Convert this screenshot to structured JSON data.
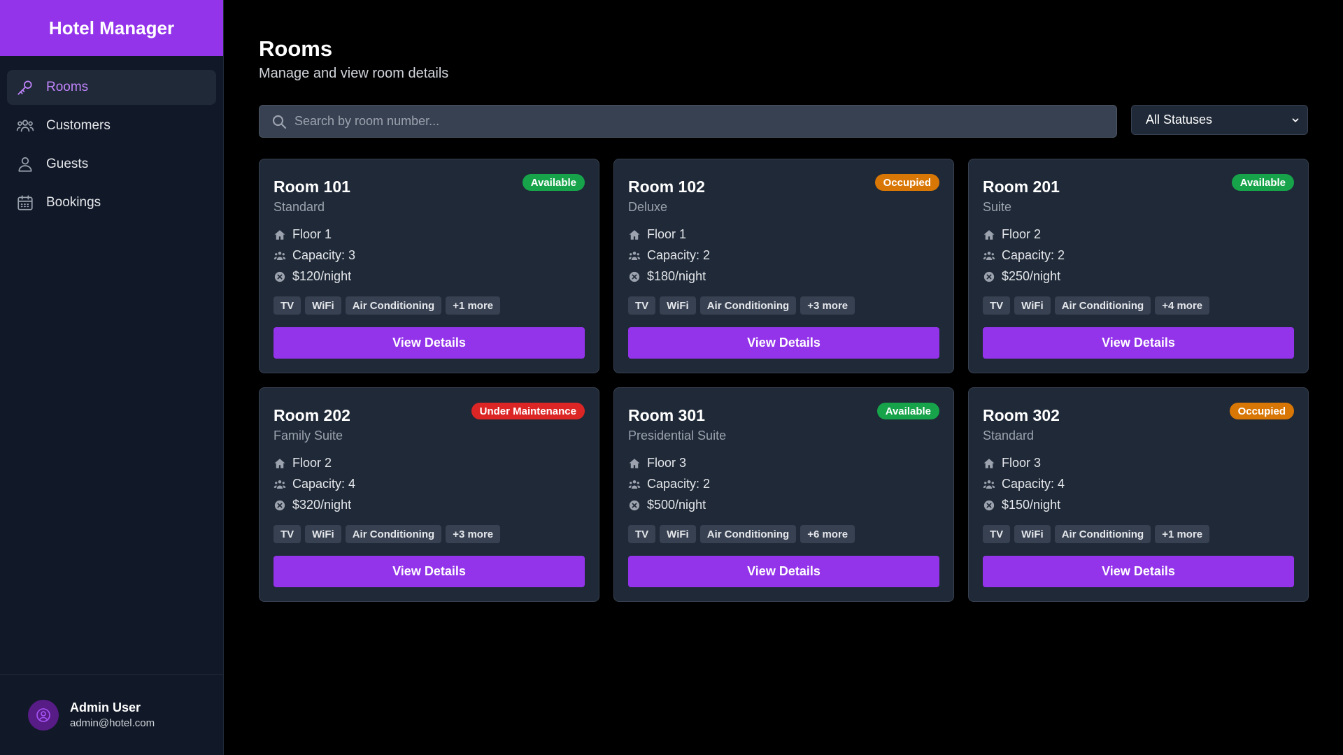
{
  "app": {
    "title": "Hotel Manager"
  },
  "sidebar": {
    "items": [
      {
        "label": "Rooms",
        "icon": "key-icon",
        "active": true
      },
      {
        "label": "Customers",
        "icon": "users-icon",
        "active": false
      },
      {
        "label": "Guests",
        "icon": "user-icon",
        "active": false
      },
      {
        "label": "Bookings",
        "icon": "calendar-icon",
        "active": false
      }
    ]
  },
  "user": {
    "name": "Admin User",
    "email": "admin@hotel.com",
    "icon": "user-circle-icon"
  },
  "page": {
    "title": "Rooms",
    "subtitle": "Manage and view room details"
  },
  "search": {
    "placeholder": "Search by room number...",
    "value": ""
  },
  "filter": {
    "selected": "All Statuses"
  },
  "colors": {
    "accent": "#9333ea",
    "available": "#16a34a",
    "occupied": "#d97706",
    "maintenance": "#dc2626"
  },
  "rooms": [
    {
      "name": "Room 101",
      "type": "Standard",
      "status": "Available",
      "status_key": "available",
      "floor": "Floor 1",
      "capacity": "Capacity: 3",
      "price": "$120/night",
      "tags": [
        "TV",
        "WiFi",
        "Air Conditioning",
        "+1 more"
      ],
      "button": "View Details"
    },
    {
      "name": "Room 102",
      "type": "Deluxe",
      "status": "Occupied",
      "status_key": "occupied",
      "floor": "Floor 1",
      "capacity": "Capacity: 2",
      "price": "$180/night",
      "tags": [
        "TV",
        "WiFi",
        "Air Conditioning",
        "+3 more"
      ],
      "button": "View Details"
    },
    {
      "name": "Room 201",
      "type": "Suite",
      "status": "Available",
      "status_key": "available",
      "floor": "Floor 2",
      "capacity": "Capacity: 2",
      "price": "$250/night",
      "tags": [
        "TV",
        "WiFi",
        "Air Conditioning",
        "+4 more"
      ],
      "button": "View Details"
    },
    {
      "name": "Room 202",
      "type": "Family Suite",
      "status": "Under Maintenance",
      "status_key": "maintenance",
      "floor": "Floor 2",
      "capacity": "Capacity: 4",
      "price": "$320/night",
      "tags": [
        "TV",
        "WiFi",
        "Air Conditioning",
        "+3 more"
      ],
      "button": "View Details"
    },
    {
      "name": "Room 301",
      "type": "Presidential Suite",
      "status": "Available",
      "status_key": "available",
      "floor": "Floor 3",
      "capacity": "Capacity: 2",
      "price": "$500/night",
      "tags": [
        "TV",
        "WiFi",
        "Air Conditioning",
        "+6 more"
      ],
      "button": "View Details"
    },
    {
      "name": "Room 302",
      "type": "Standard",
      "status": "Occupied",
      "status_key": "occupied",
      "floor": "Floor 3",
      "capacity": "Capacity: 4",
      "price": "$150/night",
      "tags": [
        "TV",
        "WiFi",
        "Air Conditioning",
        "+1 more"
      ],
      "button": "View Details"
    }
  ]
}
